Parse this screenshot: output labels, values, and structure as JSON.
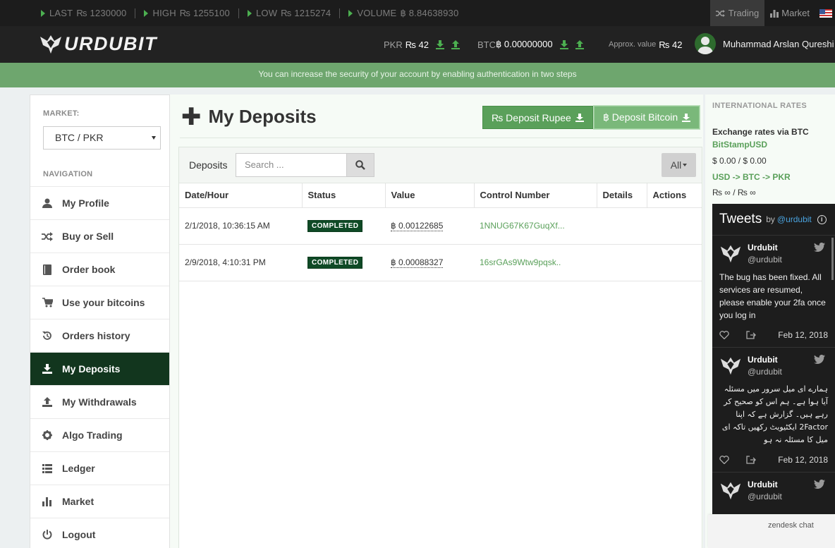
{
  "ticker": [
    {
      "label": "LAST",
      "value": "₨ 1230000"
    },
    {
      "label": "HIGH",
      "value": "₨ 1255100"
    },
    {
      "label": "LOW",
      "value": "₨ 1215274"
    },
    {
      "label": "VOLUME",
      "value": "฿ 8.84638930"
    }
  ],
  "top_links": {
    "trading": "Trading",
    "market": "Market"
  },
  "logo": {
    "text": "URDUBIT"
  },
  "balances": {
    "pkr_label": "PKR",
    "pkr_value": "₨ 42",
    "btc_label": "BTC",
    "btc_value": "฿ 0.00000000",
    "approx_label": "Approx. value",
    "approx_value": "₨ 42"
  },
  "user": {
    "name": "Muhammad Arslan Qureshi"
  },
  "alert": {
    "text": "You can increase the security of your account by enabling authentication in two steps"
  },
  "sidebar": {
    "market_label": "MARKET:",
    "market_value": "BTC / PKR",
    "nav_label": "NAVIGATION",
    "items": [
      {
        "label": "My Profile",
        "icon": "user-icon"
      },
      {
        "label": "Buy or Sell",
        "icon": "shuffle-icon"
      },
      {
        "label": "Order book",
        "icon": "book-icon"
      },
      {
        "label": "Use your bitcoins",
        "icon": "cart-icon"
      },
      {
        "label": "Orders history",
        "icon": "history-icon"
      },
      {
        "label": "My Deposits",
        "icon": "download-icon",
        "active": true
      },
      {
        "label": "My Withdrawals",
        "icon": "upload-icon"
      },
      {
        "label": "Algo Trading",
        "icon": "gear-icon"
      },
      {
        "label": "Ledger",
        "icon": "list-icon"
      },
      {
        "label": "Market",
        "icon": "bar-chart-icon"
      },
      {
        "label": "Logout",
        "icon": "power-icon"
      }
    ]
  },
  "main": {
    "title": "My Deposits",
    "deposit_rupee": "₨ Deposit Rupee",
    "deposit_bitcoin": "฿ Deposit Bitcoin",
    "panel_title": "Deposits",
    "search_placeholder": "Search ...",
    "filter_label": "All",
    "columns": [
      "Date/Hour",
      "Status",
      "Value",
      "Control Number",
      "Details",
      "Actions"
    ],
    "rows": [
      {
        "date": "2/1/2018, 10:36:15 AM",
        "status": "COMPLETED",
        "value": "฿ 0.00122685",
        "control": "1NNUG67K67GuqXf...",
        "details": "",
        "actions": ""
      },
      {
        "date": "2/9/2018, 4:10:31 PM",
        "status": "COMPLETED",
        "value": "฿ 0.00088327",
        "control": "16srGAs9Wtw9pqsk..",
        "details": "",
        "actions": ""
      }
    ]
  },
  "rates": {
    "heading": "INTERNATIONAL RATES",
    "title": "Exchange rates via BTC",
    "source": "BitStampUSD",
    "usd_values": "$ 0.00 / $ 0.00",
    "path": "USD -> BTC -> PKR",
    "pkr_values": "₨ ∞ / ₨ ∞"
  },
  "tweets": {
    "title": "Tweets",
    "by": "by",
    "handle": "@urdubit",
    "items": [
      {
        "name": "Urdubit",
        "handle": "@urdubit",
        "text": "The bug has been fixed. All services are resumed, please enable your 2fa once you log in",
        "date": "Feb 12, 2018",
        "rtl": false
      },
      {
        "name": "Urdubit",
        "handle": "@urdubit",
        "text": "ہمارے ای میل سرور میں مسئلہ آیا ہوا ہے۔ ہم اس کو صحیح کر رہے ہیں۔ گزارش ہے کہ اپنا 2Factor ایکٹیویٹ رکھیں تاکہ ای میل کا مسئلہ نہ ہو",
        "date": "Feb 12, 2018",
        "rtl": true
      },
      {
        "name": "Urdubit",
        "handle": "@urdubit",
        "text": "",
        "date": "",
        "rtl": false
      }
    ]
  },
  "zendesk": {
    "label": "zendesk chat"
  }
}
